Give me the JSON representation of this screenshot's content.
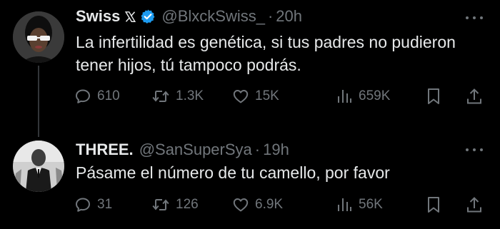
{
  "colors": {
    "background": "#000000",
    "primary_text": "#e7e9ea",
    "secondary_text": "#71767b",
    "verified_blue": "#1d9bf0",
    "thread_line": "#333639"
  },
  "tweets": [
    {
      "name": "Swiss",
      "has_x_badge": true,
      "verified": true,
      "handle": "@BlxckSwiss_",
      "separator": "·",
      "time": "20h",
      "text": "La infertilidad es genética, si tus padres no pudieron tener hijos, tú tampoco podrás.",
      "replies": "610",
      "retweets": "1.3K",
      "likes": "15K",
      "views": "659K",
      "icons": [
        "reply-icon",
        "retweet-icon",
        "like-icon",
        "views-icon",
        "bookmark-icon",
        "share-icon"
      ]
    },
    {
      "name": "THREE.",
      "has_x_badge": false,
      "verified": false,
      "handle": "@SanSuperSya",
      "separator": "·",
      "time": "19h",
      "text": "Pásame el número de tu camello, por favor",
      "replies": "31",
      "retweets": "126",
      "likes": "6.9K",
      "views": "56K",
      "icons": [
        "reply-icon",
        "retweet-icon",
        "like-icon",
        "views-icon",
        "bookmark-icon",
        "share-icon"
      ]
    }
  ]
}
